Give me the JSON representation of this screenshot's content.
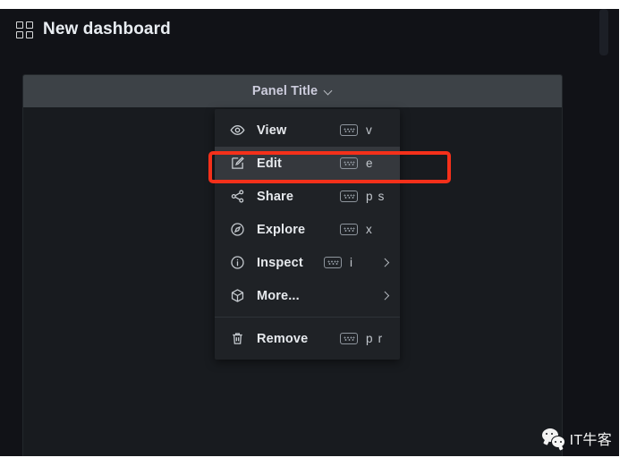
{
  "app": {
    "background_color": "#111217",
    "dashboard_icon": "grid-4-squares-icon",
    "dashboard_title": "New dashboard"
  },
  "panel": {
    "title": "Panel Title",
    "title_chevron_icon": "chevron-down-icon",
    "header_color": "#3d4247",
    "body_color": "#181b1f"
  },
  "menu": {
    "background_color": "#1f2226",
    "items": [
      {
        "icon": "eye-icon",
        "label": "View",
        "kbd_icon": "keyboard-icon",
        "shortcut": "v",
        "has_submenu": false,
        "highlighted": false
      },
      {
        "icon": "pencil-square-icon",
        "label": "Edit",
        "kbd_icon": "keyboard-icon",
        "shortcut": "e",
        "has_submenu": false,
        "highlighted": true
      },
      {
        "icon": "share-nodes-icon",
        "label": "Share",
        "kbd_icon": "keyboard-icon",
        "shortcut": "p s",
        "has_submenu": false,
        "highlighted": false
      },
      {
        "icon": "compass-icon",
        "label": "Explore",
        "kbd_icon": "keyboard-icon",
        "shortcut": "x",
        "has_submenu": false,
        "highlighted": false
      },
      {
        "icon": "info-circle-icon",
        "label": "Inspect",
        "kbd_icon": "keyboard-icon",
        "shortcut": "i",
        "has_submenu": true,
        "highlighted": false
      },
      {
        "icon": "cube-icon",
        "label": "More...",
        "kbd_icon": null,
        "shortcut": "",
        "has_submenu": true,
        "highlighted": false
      }
    ],
    "remove_item": {
      "icon": "trash-icon",
      "label": "Remove",
      "kbd_icon": "keyboard-icon",
      "shortcut": "p r"
    }
  },
  "annotation": {
    "highlight_color": "#f4301a",
    "target": "Edit"
  },
  "watermark": {
    "logo": "wechat-icon",
    "text": "IT牛客"
  }
}
